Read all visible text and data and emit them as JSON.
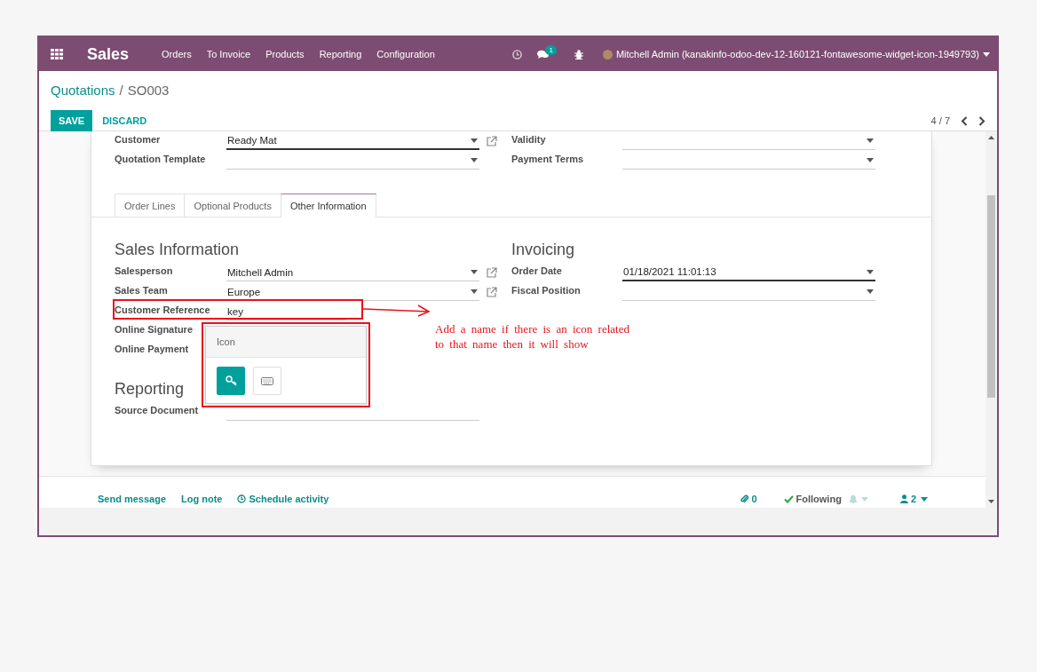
{
  "navbar": {
    "app": "Sales",
    "menu": [
      "Orders",
      "To Invoice",
      "Products",
      "Reporting",
      "Configuration"
    ],
    "messages_badge": "1",
    "user": "Mitchell Admin (kanakinfo-odoo-dev-12-160121-fontawesome-widget-icon-1949793)"
  },
  "breadcrumb": {
    "parent": "Quotations",
    "separator": "/",
    "current": "SO003"
  },
  "actions": {
    "save": "SAVE",
    "discard": "DISCARD"
  },
  "pager": "4 / 7",
  "header_fields": {
    "left": [
      {
        "label": "Customer",
        "value": "Ready Mat",
        "kind": "select",
        "link": true,
        "required": true
      },
      {
        "label": "Quotation Template",
        "kind": "select",
        "link": false,
        "required": false
      }
    ],
    "right": [
      {
        "label": "Validity",
        "kind": "select",
        "link": false,
        "required": false
      },
      {
        "label": "Payment Terms",
        "kind": "select",
        "link": false,
        "required": false
      }
    ]
  },
  "tabs": [
    {
      "label": "Order Lines",
      "selected": false
    },
    {
      "label": "Optional Products",
      "selected": false
    },
    {
      "label": "Other Information",
      "selected": true
    }
  ],
  "left_sections": [
    {
      "title": "Sales Information",
      "fields": [
        {
          "label": "Salesperson",
          "value": "Mitchell Admin",
          "kind": "select",
          "link": true,
          "required": false
        },
        {
          "label": "Sales Team",
          "value": "Europe",
          "kind": "select",
          "link": true,
          "required": false
        },
        {
          "label": "Customer Reference",
          "value": "key",
          "kind": "icon_text",
          "link": false,
          "required": false
        },
        {
          "label": "Online Signature",
          "kind": "none"
        },
        {
          "label": "Online Payment",
          "kind": "none"
        }
      ]
    },
    {
      "title": "Reporting",
      "fields": [
        {
          "label": "Source Document",
          "kind": "text",
          "link": false,
          "required": false
        }
      ]
    }
  ],
  "right_sections": [
    {
      "title": "Invoicing",
      "fields": [
        {
          "label": "Order Date",
          "value": "01/18/2021 11:01:13",
          "kind": "select",
          "link": false,
          "required": true
        },
        {
          "label": "Fiscal Position",
          "kind": "select",
          "link": false,
          "required": false
        }
      ]
    }
  ],
  "icon_popup": {
    "title": "Icon",
    "icons": [
      {
        "kind": "key",
        "selected": true
      },
      {
        "kind": "keyboard",
        "selected": false
      }
    ]
  },
  "annotation": {
    "lines": [
      "Add a name if there is an icon related",
      "to that name then it will show"
    ]
  },
  "chatter": {
    "send": "Send message",
    "log": "Log note",
    "schedule": "Schedule activity",
    "attachments": "0",
    "following": "Following",
    "followers": "2"
  }
}
